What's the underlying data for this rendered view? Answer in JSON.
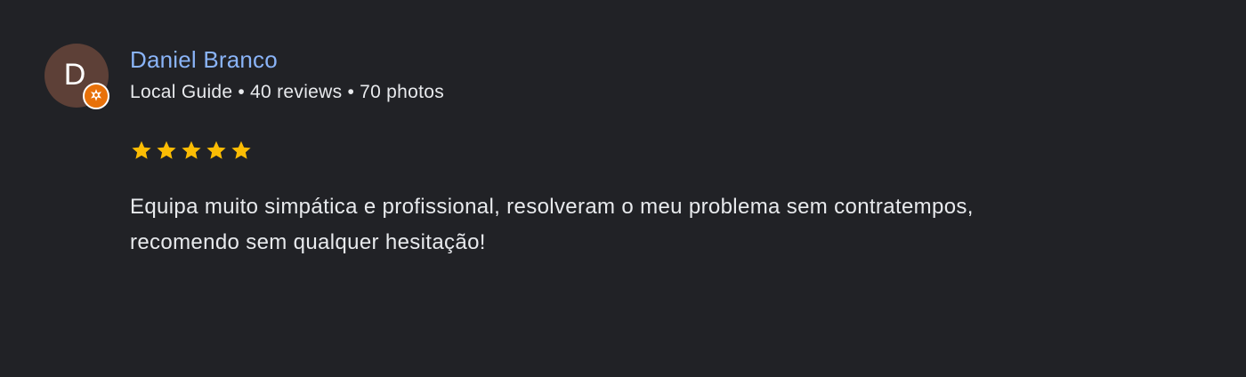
{
  "reviewer": {
    "initial": "D",
    "name": "Daniel Branco",
    "avatar_color": "#5d4037",
    "badge_icon": "local-guide-icon",
    "badge_color": "#e8710a",
    "role": "Local Guide",
    "reviews": "40 reviews",
    "photos": "70 photos",
    "separator": "•"
  },
  "rating": {
    "value": 5,
    "max": 5,
    "star_color": "#fbbc04"
  },
  "review": {
    "line1": "Equipa muito simpática e profissional, resolveram o meu problema sem contratempos,",
    "line2": "recomendo sem qualquer hesitação!"
  },
  "colors": {
    "background": "#212226",
    "name": "#8ab4f8",
    "text": "#e8eaed"
  }
}
